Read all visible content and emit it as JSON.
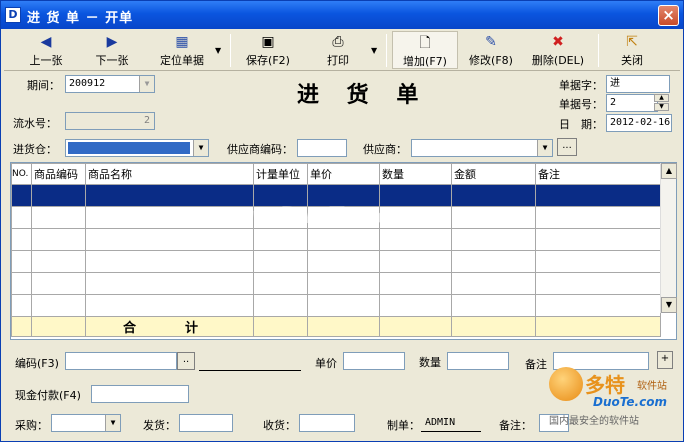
{
  "window": {
    "title": "进 货 单 － 开单",
    "title_icon": "document-icon"
  },
  "toolbar": {
    "prev": "上一张",
    "next": "下一张",
    "locate": "定位单据",
    "save": "保存(F2)",
    "print": "打印",
    "add": "增加(F7)",
    "edit": "修改(F8)",
    "delete": "删除(DEL)",
    "close": "关闭"
  },
  "header": {
    "period_label": "期间：",
    "period_value": "200912",
    "serial_label": "流水号：",
    "serial_value": "2",
    "doc_title": "进  货  单",
    "doc_word_label": "单据字：",
    "doc_word_value": "进",
    "doc_no_label": "单据号：",
    "doc_no_value": "2",
    "date_label": "日　期：",
    "date_value": "2012-02-16"
  },
  "filters": {
    "warehouse_label": "进货仓：",
    "supplier_code_label": "供应商编码：",
    "supplier_label": "供应商：",
    "ellipsis": "..."
  },
  "grid": {
    "columns": [
      "NO.",
      "商品编码",
      "商品名称",
      "计量单位",
      "单价",
      "数量",
      "金额",
      "备注"
    ],
    "total_label": "合　计"
  },
  "entry": {
    "code_label": "编码(F3)",
    "code_btn": "..",
    "price_label": "单价",
    "qty_label": "数量",
    "remark_label": "备注",
    "plus": "+",
    "cash_label": "现金付款(F4)"
  },
  "footer": {
    "buyer_label": "采购：",
    "ship_label": "发货：",
    "receive_label": "收货：",
    "maker_label": "制单：",
    "maker_value": "ADMIN",
    "remark_label": "备注："
  },
  "watermark": "www.DuoTe.com",
  "logo": {
    "big": "多特",
    "small": "软件站",
    "domain": "DuoTe.com",
    "tagline": "国内最安全的软件站"
  }
}
